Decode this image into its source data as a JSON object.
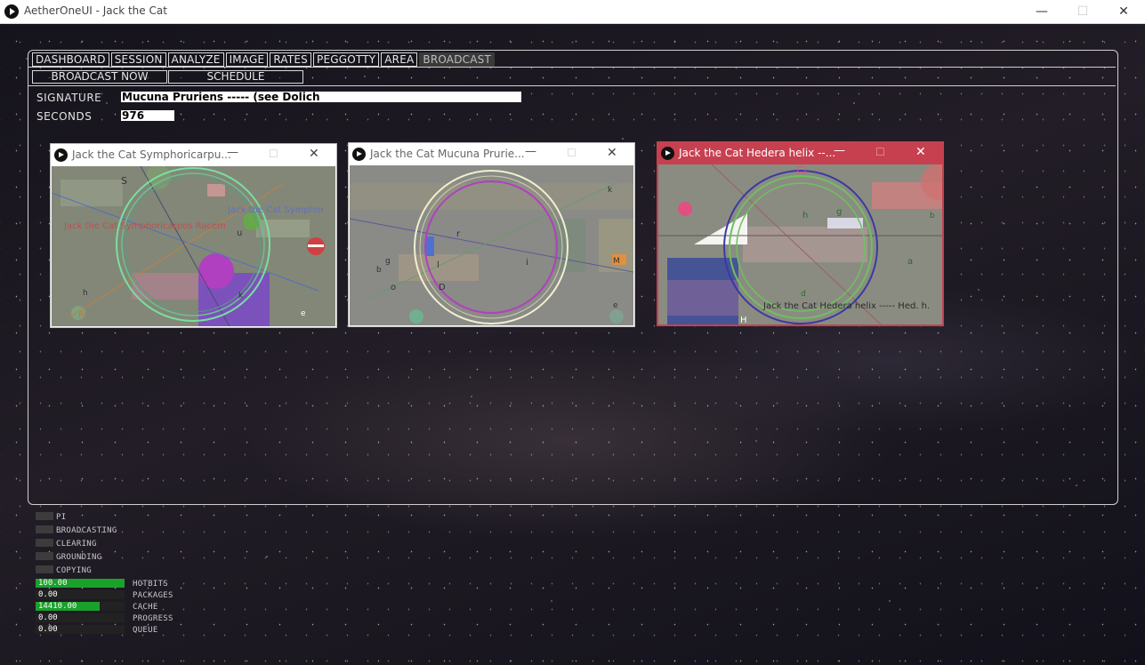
{
  "window": {
    "title": "AetherOneUI - Jack the Cat",
    "minimize": "—",
    "maximize": "☐",
    "close": "✕"
  },
  "tabs": [
    "DASHBOARD",
    "SESSION",
    "ANALYZE",
    "IMAGE",
    "RATES",
    "PEGGOTTY",
    "AREA",
    "BROADCAST"
  ],
  "active_tab": "BROADCAST",
  "actions": {
    "broadcast_now": "BROADCAST NOW",
    "schedule": "SCHEDULE"
  },
  "fields": {
    "signature_label": "SIGNATURE",
    "signature_value": "Mucuna Pruriens ----- (see Dolich",
    "seconds_label": "SECONDS",
    "seconds_value": "976"
  },
  "broadcast_windows": [
    {
      "title": "Jack the Cat Symphoricarpu...",
      "overlay_texts": [
        "S",
        "Jack the Cat Symphor",
        "Jack the Cat Symphoricarpos Racem",
        "u",
        "h",
        "R",
        "e",
        "k"
      ]
    },
    {
      "title": "Jack the Cat Mucuna Prurie...",
      "overlay_texts": [
        "r",
        "l",
        "i",
        "D",
        "M",
        "b",
        "o",
        "k",
        "e",
        "g"
      ]
    },
    {
      "title": "Jack the Cat Hedera helix --...",
      "overlay_texts": [
        "Jack the Cat Hedera helix ----- Hed. h.",
        "h",
        "a",
        "g",
        "b",
        "H",
        "d"
      ]
    }
  ],
  "status": {
    "indicators": [
      "PI",
      "BROADCASTING",
      "CLEARING",
      "GROUNDING",
      "COPYING"
    ],
    "bars": [
      {
        "label": "HOTBITS",
        "value": "100.00",
        "fill": 1.0
      },
      {
        "label": "PACKAGES",
        "value": "0.00",
        "fill": 0.0
      },
      {
        "label": "CACHE",
        "value": "14410.00",
        "fill": 0.72
      },
      {
        "label": "PROGRESS",
        "value": "0.00",
        "fill": 0.0
      },
      {
        "label": "QUEUE",
        "value": "0.00",
        "fill": 0.0
      }
    ]
  },
  "colors": {
    "active_window": "#c74050",
    "bar_fill": "#1aa12a",
    "tab_active_bg": "#3a3a3a"
  }
}
